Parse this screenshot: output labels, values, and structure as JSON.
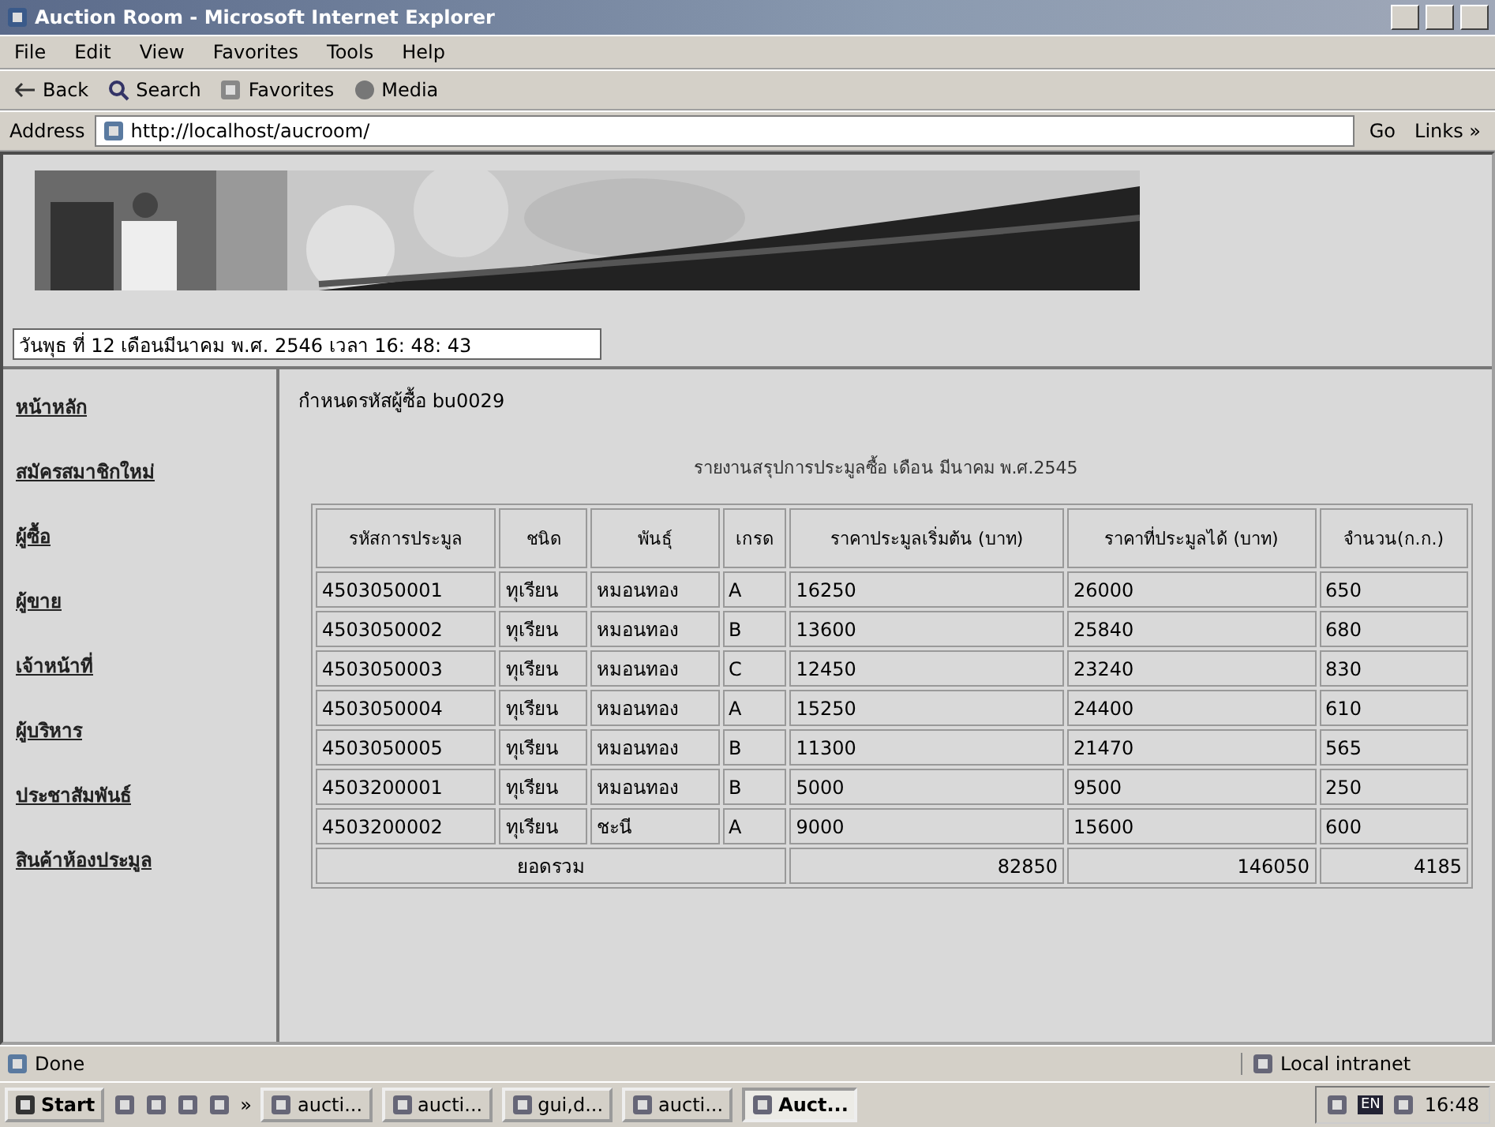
{
  "window": {
    "title": "Auction Room - Microsoft Internet Explorer"
  },
  "menu": [
    "File",
    "Edit",
    "View",
    "Favorites",
    "Tools",
    "Help"
  ],
  "toolbar": [
    {
      "kind": "back",
      "label": "Back"
    },
    {
      "kind": "search",
      "label": "Search"
    },
    {
      "kind": "favorites",
      "label": "Favorites"
    },
    {
      "kind": "media",
      "label": "Media"
    }
  ],
  "address": {
    "label": "Address",
    "url": "http://localhost/aucroom/",
    "go": "Go",
    "links": "Links »"
  },
  "page": {
    "datetime": "วันพุธ ที่ 12 เดือนมีนาคม พ.ศ. 2546 เวลา 16: 48: 43",
    "nav": [
      "หน้าหลัก",
      "สมัครสมาชิกใหม่",
      "ผู้ซื้อ",
      "ผู้ขาย",
      "เจ้าหน้าที่",
      "ผู้บริหาร",
      "ประชาสัมพันธ์",
      "สินค้าห้องประมูล"
    ],
    "buyer": "กำหนดรหัสผู้ซื้อ bu0029",
    "report_title": "รายงานสรุปการประมูลซื้อ เดือน มีนาคม พ.ศ.2545",
    "table": {
      "columns": [
        "รหัสการประมูล",
        "ชนิด",
        "พันธุ์",
        "เกรด",
        "ราคาประมูลเริ่มต้น (บาท)",
        "ราคาที่ประมูลได้ (บาท)",
        "จำนวน(ก.ก.)"
      ],
      "rows": [
        [
          "4503050001",
          "ทุเรียน",
          "หมอนทอง",
          "A",
          "16250",
          "26000",
          "650"
        ],
        [
          "4503050002",
          "ทุเรียน",
          "หมอนทอง",
          "B",
          "13600",
          "25840",
          "680"
        ],
        [
          "4503050003",
          "ทุเรียน",
          "หมอนทอง",
          "C",
          "12450",
          "23240",
          "830"
        ],
        [
          "4503050004",
          "ทุเรียน",
          "หมอนทอง",
          "A",
          "15250",
          "24400",
          "610"
        ],
        [
          "4503050005",
          "ทุเรียน",
          "หมอนทอง",
          "B",
          "11300",
          "21470",
          "565"
        ],
        [
          "4503200001",
          "ทุเรียน",
          "หมอนทอง",
          "B",
          "5000",
          "9500",
          "250"
        ],
        [
          "4503200002",
          "ทุเรียน",
          "ชะนี",
          "A",
          "9000",
          "15600",
          "600"
        ]
      ],
      "total": {
        "label": "ยอดรวม",
        "values": [
          "82850",
          "146050",
          "4185"
        ]
      }
    }
  },
  "status_bar": {
    "text": "Done",
    "zone": "Local intranet"
  },
  "taskbar": {
    "start": "Start",
    "more": "»",
    "tasks": [
      {
        "label": "aucti...",
        "selected": false
      },
      {
        "label": "aucti...",
        "selected": false
      },
      {
        "label": "gui,d...",
        "selected": false
      },
      {
        "label": "aucti...",
        "selected": false
      },
      {
        "label": "Auct...",
        "selected": true
      }
    ],
    "lang": "EN",
    "clock": "16:48"
  }
}
